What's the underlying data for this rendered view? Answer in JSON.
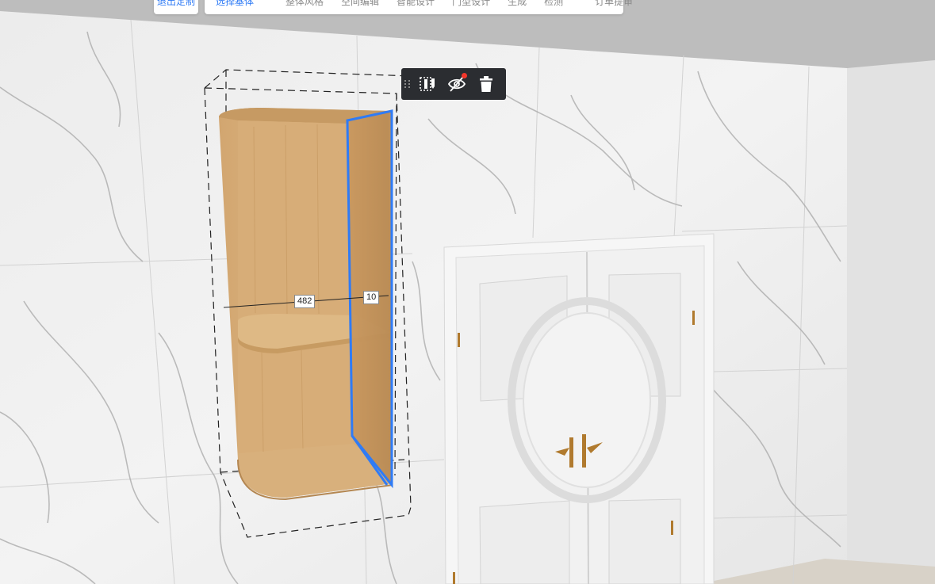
{
  "top_bar": {
    "exit_label": "退出定制",
    "tabs": [
      {
        "label": "选择基体",
        "active": true
      },
      {
        "label": "整体风格",
        "active": false
      },
      {
        "label": "空间编辑",
        "active": false
      },
      {
        "label": "智能设计",
        "active": false
      },
      {
        "label": "门型设计",
        "active": false
      },
      {
        "label": "生成",
        "active": false
      },
      {
        "label": "检测",
        "active": false
      },
      {
        "label": "订单提审",
        "active": false
      }
    ]
  },
  "selection_toolbar": {
    "buttons": [
      {
        "icon": "edit-panel-icon"
      },
      {
        "icon": "hide-eye-icon",
        "badge_color": "#f2362b"
      },
      {
        "icon": "trash-icon"
      }
    ]
  },
  "dimensions": {
    "width_label": "482",
    "panel_label": "10"
  },
  "colors": {
    "accent": "#2f7bf5",
    "selection_outline": "#2f7bf5",
    "toolbar_bg": "#2b2d31",
    "wood": "#d9b07c",
    "door": "#f4f4f4"
  }
}
